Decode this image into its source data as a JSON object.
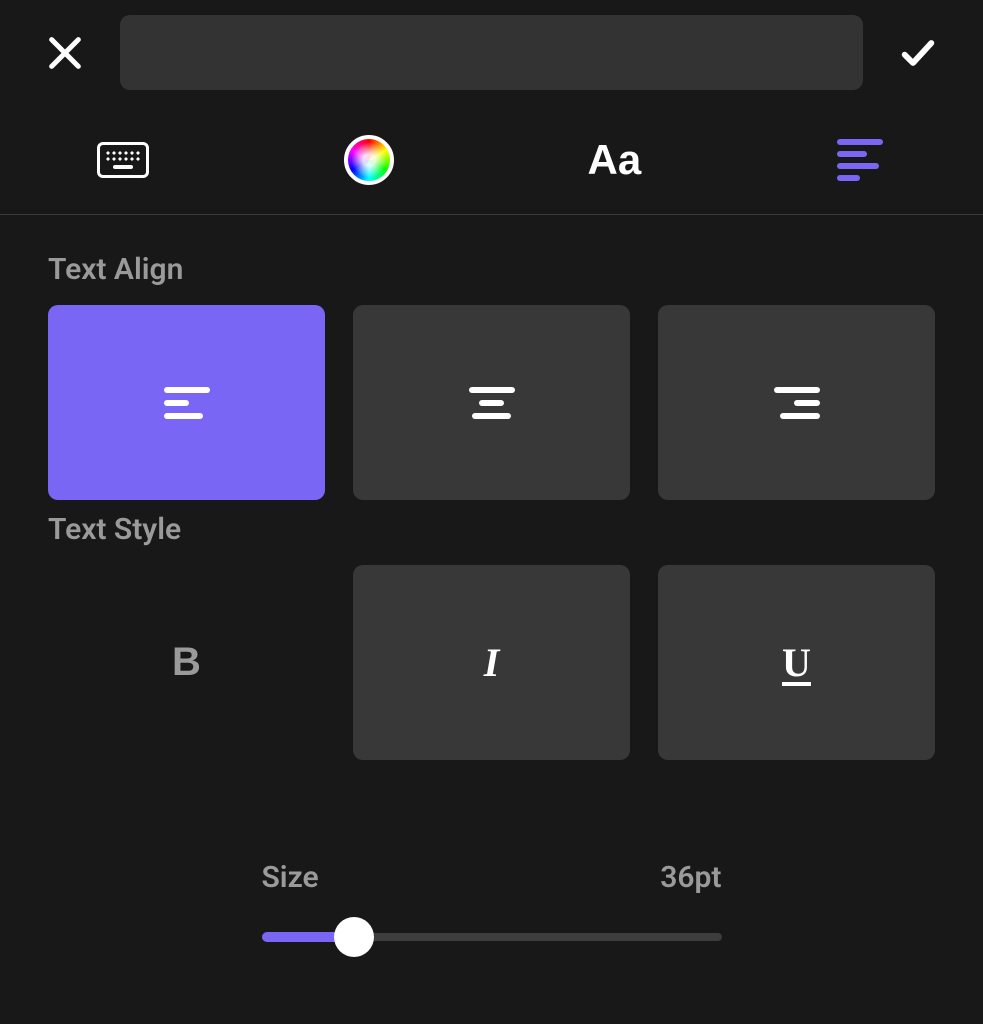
{
  "header": {
    "close": "Close",
    "confirm": "Confirm",
    "input_value": ""
  },
  "tabs": {
    "keyboard": "keyboard",
    "color": "color",
    "font": "Aa",
    "align": "paragraph",
    "active": "align"
  },
  "sections": {
    "align_label": "Text Align",
    "style_label": "Text Style"
  },
  "align_options": {
    "left": {
      "selected": true,
      "name": "Align Left"
    },
    "center": {
      "selected": false,
      "name": "Align Center"
    },
    "right": {
      "selected": false,
      "name": "Align Right"
    }
  },
  "style_options": {
    "bold": {
      "glyph": "B",
      "selected": false
    },
    "italic": {
      "glyph": "I",
      "selected": false
    },
    "underline": {
      "glyph": "U",
      "selected": false
    }
  },
  "size": {
    "label": "Size",
    "value_display": "36pt",
    "percent": 20
  },
  "colors": {
    "accent": "#7A66F4",
    "tile": "#383838",
    "bg": "#181818"
  }
}
